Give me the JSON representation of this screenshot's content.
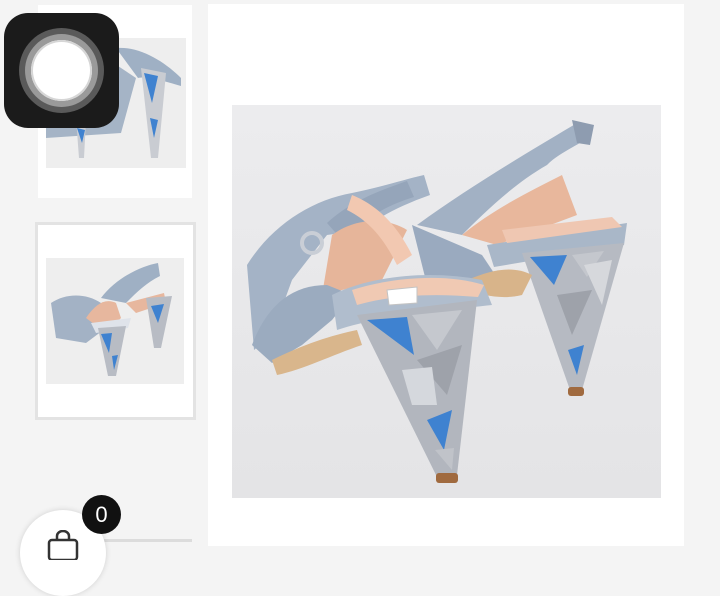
{
  "cart": {
    "count": "0"
  },
  "images": {
    "thumbnails": [
      {
        "icon": "shoe-heel-thumbnail",
        "selected": false
      },
      {
        "icon": "shoe-pair-back-thumbnail",
        "selected": true
      }
    ],
    "main": {
      "icon": "shoe-pair-back-photo"
    }
  },
  "colors": {
    "suede": "#9fb0c4",
    "lining": "#e7b79e",
    "heel_blue": "#3f82d0",
    "heel_grey": "#a9acb3",
    "background": "#f4f4f4"
  }
}
